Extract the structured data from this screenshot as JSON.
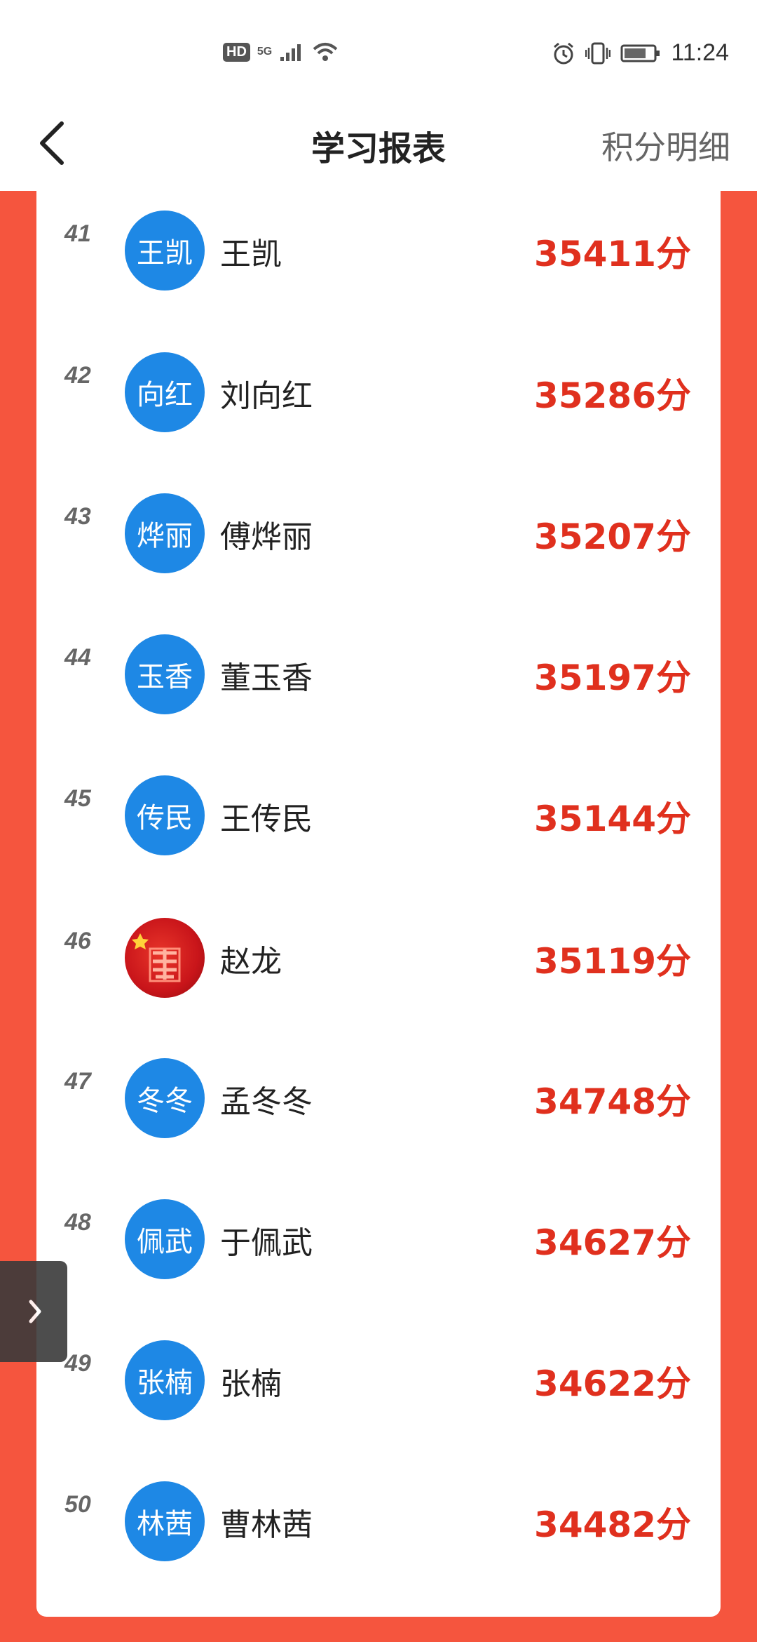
{
  "status_bar": {
    "left_badge": "HD",
    "network": "5G",
    "time": "11:24"
  },
  "header": {
    "title": "学习报表",
    "right_link": "积分明细"
  },
  "colors": {
    "accent_red": "#e0301e",
    "background_red": "#f5553e",
    "avatar_blue": "#1e88e5"
  },
  "rows": [
    {
      "rank": "41",
      "avatar_text": "王凯",
      "name": "王凯",
      "score": "35411分"
    },
    {
      "rank": "42",
      "avatar_text": "向红",
      "name": "刘向红",
      "score": "35286分"
    },
    {
      "rank": "43",
      "avatar_text": "烨丽",
      "name": "傅烨丽",
      "score": "35207分"
    },
    {
      "rank": "44",
      "avatar_text": "玉香",
      "name": "董玉香",
      "score": "35197分"
    },
    {
      "rank": "45",
      "avatar_text": "传民",
      "name": "王传民",
      "score": "35144分"
    },
    {
      "rank": "46",
      "avatar_text": "",
      "name": "赵龙",
      "score": "35119分"
    },
    {
      "rank": "47",
      "avatar_text": "冬冬",
      "name": "孟冬冬",
      "score": "34748分"
    },
    {
      "rank": "48",
      "avatar_text": "佩武",
      "name": "于佩武",
      "score": "34627分"
    },
    {
      "rank": "49",
      "avatar_text": "张楠",
      "name": "张楠",
      "score": "34622分"
    },
    {
      "rank": "50",
      "avatar_text": "林茜",
      "name": "曹林茜",
      "score": "34482分"
    }
  ]
}
